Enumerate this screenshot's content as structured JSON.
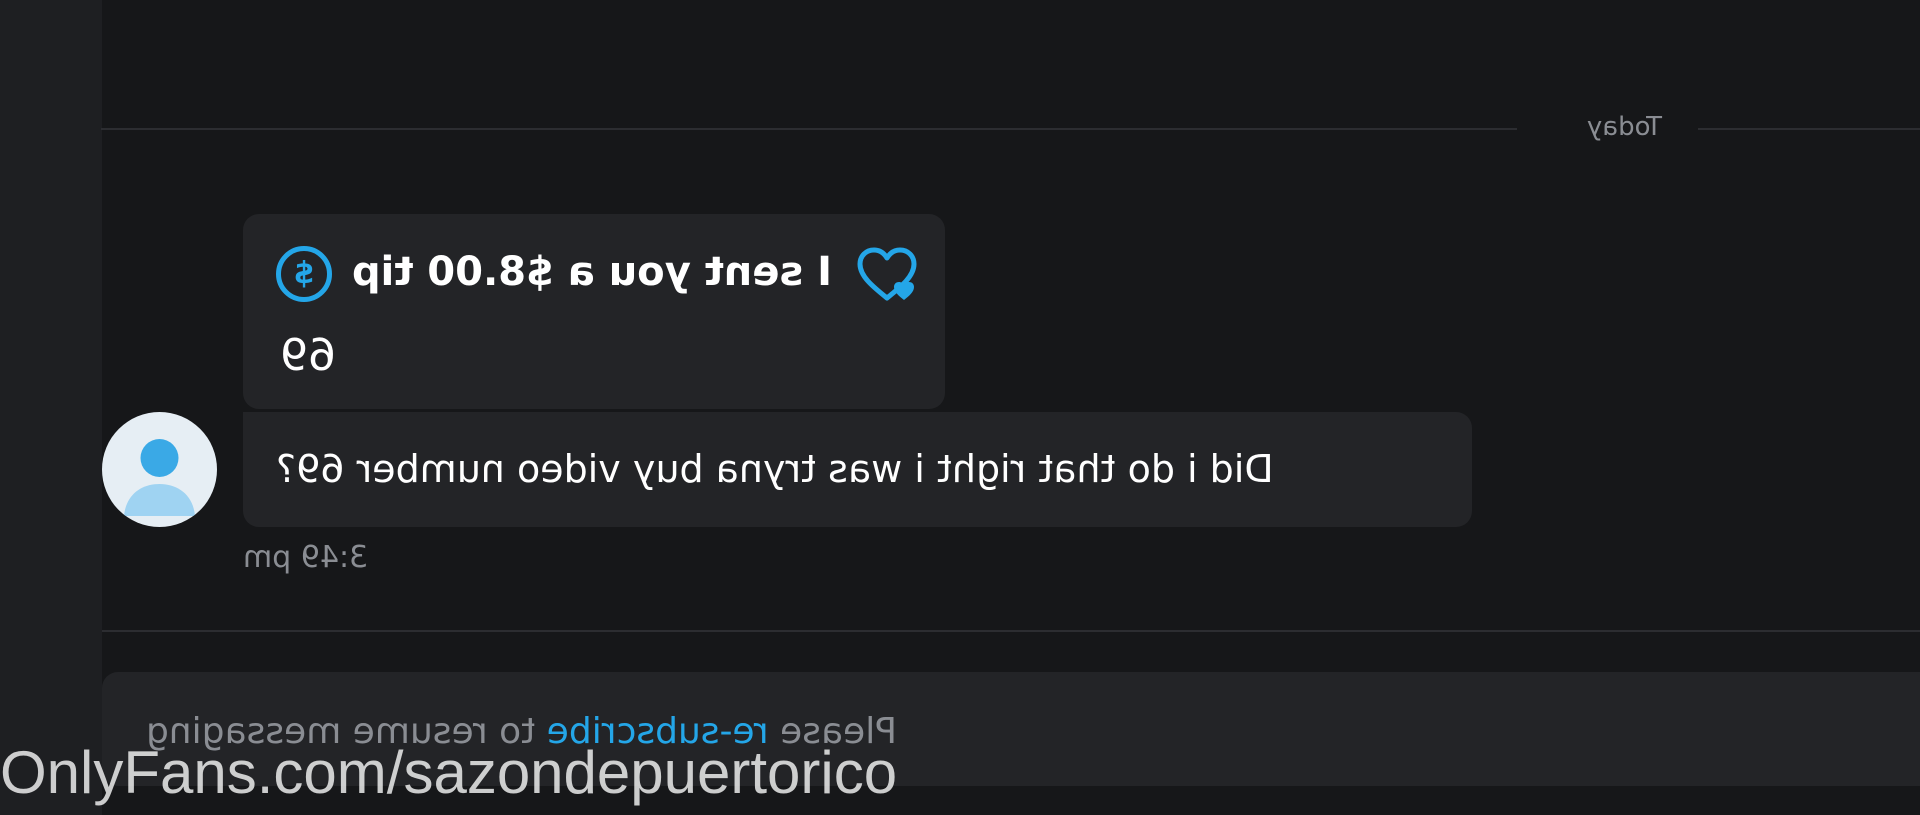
{
  "date_separator": "Today",
  "tip_message": {
    "text": "I sent you a $8.00 tip",
    "currency_symbol": "$",
    "amount_note": "69",
    "icon": "dollar-circle-icon",
    "like_icon": "heart-icon"
  },
  "message": {
    "text": "Did i do that right i was tryna buy video number 69?",
    "time": "3:49 pm",
    "avatar_icon": "user-avatar-icon"
  },
  "banner": {
    "prefix": "Please ",
    "link": "re-subscribe",
    "suffix": " to resume messaging"
  },
  "watermark": "OnlyFans.com/sazondepuertorico",
  "colors": {
    "background": "#161719",
    "bubble": "#232427",
    "accent": "#24a6e8",
    "muted_text": "#8a8d93"
  }
}
